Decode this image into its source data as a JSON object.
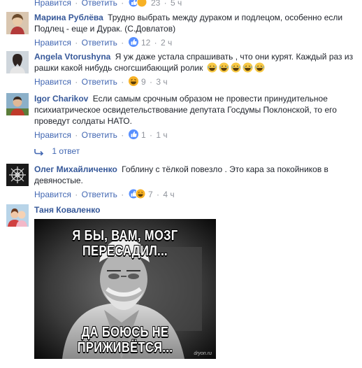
{
  "labels": {
    "like": "Нравится",
    "reply": "Ответить",
    "sep": "·"
  },
  "top_row": {
    "count": "23",
    "time": "5 ч"
  },
  "comments": [
    {
      "author": "Марина Рублёва",
      "text": "Трудно выбрать между дураком и подлецом, особенно если Подлец - еще и Дурак. (С.Довлатов)",
      "count": "12",
      "time": "2 ч"
    },
    {
      "author": "Angela Vtorushyna",
      "text": "Я уж даже устала спрашивать , что они курят. Каждый раз из рашки какой нибудь сногсшибающий ролик",
      "count": "9",
      "time": "3 ч"
    },
    {
      "author": "Igor Charikov",
      "text": "Если самым срочным образом не провести принудительное психиатрическое освидетельствование депутата Госдумы Поклонской, то его проведут солдаты НАТО.",
      "count": "1",
      "time": "1 ч"
    },
    {
      "author": "Олег Михайличенко",
      "text": "Гоблину с тёлкой повезло . Это кара за покойников в девяностые.",
      "count": "7",
      "time": "4 ч"
    },
    {
      "author": "Таня Коваленко"
    }
  ],
  "replies_label": "1 ответ",
  "meme": {
    "top_line1": "Я БЫ, ВАМ, МОЗГ",
    "top_line2": "ПЕРЕСАДИЛ...",
    "bottom_line1": "ДА БОЮСЬ НЕ",
    "bottom_line2": "ПРИЖИВЁТСЯ...",
    "watermark": "dryon.ru"
  },
  "colors": {
    "link": "#365899",
    "action": "#4267b2",
    "meta": "#90949c",
    "like": "#5890ff",
    "haha": "#f7b125"
  }
}
